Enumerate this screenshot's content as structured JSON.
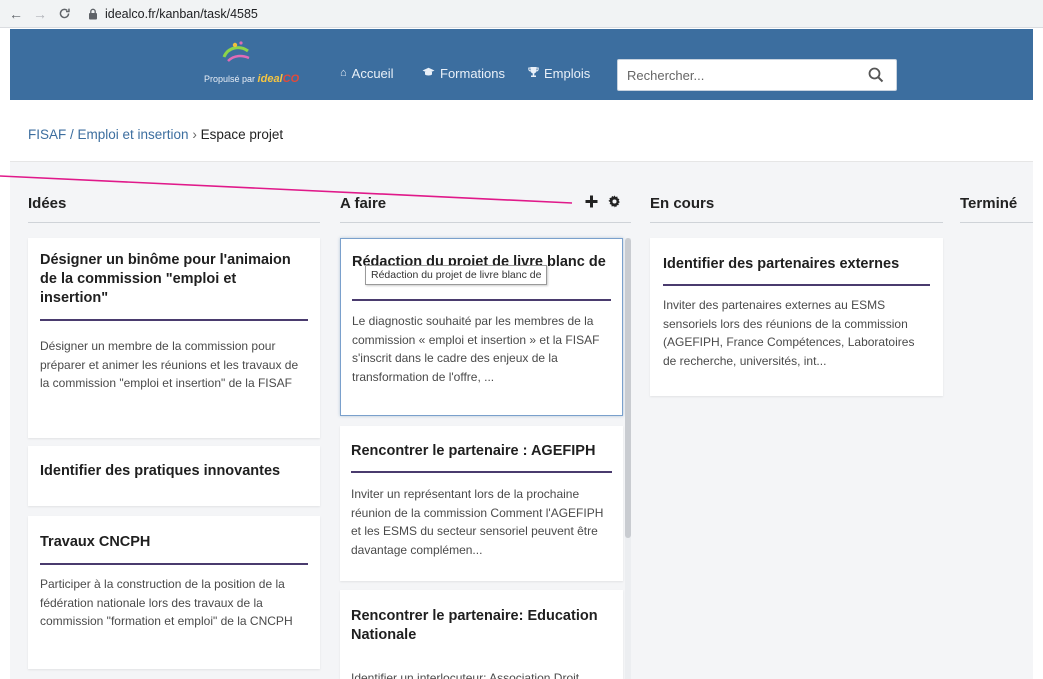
{
  "browser": {
    "url": "idealco.fr/kanban/task/4585",
    "back_icon": "arrow-left-icon",
    "forward_icon": "arrow-right-icon",
    "reload_icon": "reload-icon",
    "lock_icon": "lock-icon"
  },
  "header": {
    "logo_tagline": "Propulsé par",
    "logo_brand": "ideal",
    "logo_brand_suffix": "CO",
    "nav": [
      {
        "label": "Accueil",
        "icon": "home-icon"
      },
      {
        "label": "Formations",
        "icon": "graduation-cap-icon"
      },
      {
        "label": "Emplois",
        "icon": "trophy-icon"
      }
    ],
    "search": {
      "placeholder": "Rechercher...",
      "value": "",
      "icon": "search-icon"
    }
  },
  "breadcrumb": {
    "link": "FISAF / Emploi et insertion",
    "separator": "›",
    "current": "Espace projet"
  },
  "board": {
    "columns": [
      {
        "title": "Idées",
        "cards": [
          {
            "title": "Désigner un binôme pour l'animaion de la commission \"emploi et insertion\"",
            "text": "Désigner un membre de la commission pour préparer et animer les réunions et les travaux de la commission \"emploi et insertion\" de la FISAF"
          },
          {
            "title": "Identifier des pratiques innovantes",
            "text": ""
          },
          {
            "title": "Travaux CNCPH",
            "text": "Participer à la construction de la position de la fédération nationale lors des travaux de la commission \"formation et emploi\" de la CNCPH"
          }
        ]
      },
      {
        "title": "A faire",
        "actions": [
          {
            "icon": "plus-icon"
          },
          {
            "icon": "gear-icon"
          }
        ],
        "cards": [
          {
            "title": "Rédaction du projet de livre blanc de",
            "text": "Le diagnostic souhaité par les membres de la commission « emploi et insertion » et la FISAF s'inscrit dans le cadre des enjeux de la transformation de l'offre, ..."
          },
          {
            "title": "Rencontrer le partenaire : AGEFIPH",
            "text": "Inviter un représentant lors de la prochaine réunion de la commission Comment l'AGEFIPH et les ESMS du secteur sensoriel peuvent être davantage complémen..."
          },
          {
            "title": "Rencontrer le partenaire: Education Nationale",
            "text": "Identifier un interlocuteur: Association Droit"
          }
        ],
        "tooltip": "Rédaction du projet de livre blanc de"
      },
      {
        "title": "En cours",
        "cards": [
          {
            "title": "Identifier des partenaires externes",
            "text": "Inviter des partenaires externes au ESMS sensoriels lors des réunions de la commission (AGEFIPH, France Compétences, Laboratoires de recherche, universités, int..."
          }
        ]
      },
      {
        "title": "Terminé",
        "cards": []
      }
    ]
  },
  "colors": {
    "header_bg": "#3c6e9f",
    "card_rule": "#4a3b6e",
    "annotation_line": "#e0198a",
    "link": "#3c6e9f"
  }
}
